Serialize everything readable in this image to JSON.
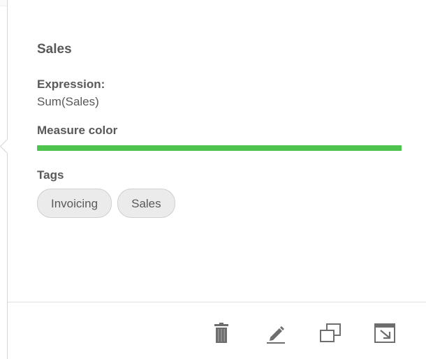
{
  "measure": {
    "title": "Sales",
    "expression_label": "Expression:",
    "expression_value": "Sum(Sales)",
    "color_label": "Measure color",
    "color_value": "#4ec44e",
    "tags_label": "Tags",
    "tags": [
      "Invoicing",
      "Sales"
    ]
  },
  "footer": {
    "actions": [
      {
        "name": "delete",
        "icon": "trash-icon"
      },
      {
        "name": "edit",
        "icon": "pencil-icon"
      },
      {
        "name": "duplicate",
        "icon": "duplicate-icon"
      },
      {
        "name": "open",
        "icon": "open-icon"
      }
    ]
  },
  "colors": {
    "text": "#595959",
    "icon": "#6e6e6e",
    "tag_bg": "#ebebeb",
    "border": "#d6d6d6"
  }
}
